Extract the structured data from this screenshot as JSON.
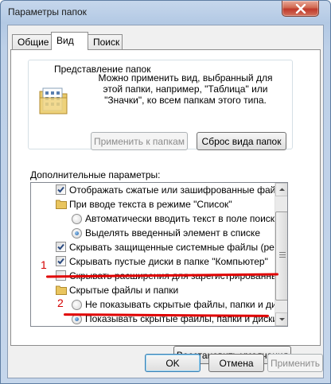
{
  "window": {
    "title": "Параметры папок"
  },
  "tabs": [
    {
      "label": "Общие",
      "active": false
    },
    {
      "label": "Вид",
      "active": true
    },
    {
      "label": "Поиск",
      "active": false
    }
  ],
  "folder_views": {
    "title": "Представление папок",
    "description": "Можно применить вид, выбранный для этой папки, например, \"Таблица\" или \"Значки\", ко всем папкам этого типа.",
    "apply_button": "Применить к папкам",
    "reset_button": "Сброс вида папок"
  },
  "advanced": {
    "label": "Дополнительные параметры:",
    "items": [
      {
        "type": "checkbox",
        "checked": true,
        "label": "Отображать сжатые или зашифрованные файлы NTI"
      },
      {
        "type": "folder",
        "label": "При вводе текста в режиме \"Список\""
      },
      {
        "type": "radio",
        "checked": false,
        "label": "Автоматически вводить текст в поле поиска"
      },
      {
        "type": "radio",
        "checked": true,
        "label": "Выделять введенный элемент в списке"
      },
      {
        "type": "checkbox",
        "checked": true,
        "label": "Скрывать защищенные системные файлы (рекомен"
      },
      {
        "type": "checkbox",
        "checked": true,
        "label": "Скрывать пустые диски в папке \"Компьютер\""
      },
      {
        "type": "checkbox",
        "checked": false,
        "label": "Скрывать расширения для зарегистрированных типо"
      },
      {
        "type": "folder",
        "label": "Скрытые файлы и папки"
      },
      {
        "type": "radio",
        "checked": false,
        "label": "Не показывать скрытые файлы, папки и диски"
      },
      {
        "type": "radio",
        "checked": true,
        "label": "Показывать скрытые файлы, папки и диски"
      }
    ]
  },
  "annotations": {
    "marker_1": "1",
    "marker_2": "2",
    "color": "#e00000"
  },
  "buttons": {
    "restore": "Восстановить умолчания",
    "ok": "OK",
    "cancel": "Отмена",
    "apply": "Применить"
  }
}
